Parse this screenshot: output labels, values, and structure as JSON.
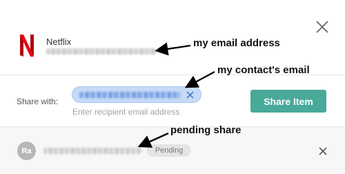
{
  "item": {
    "service_name": "Netflix",
    "owner_email_redacted": "",
    "logo_icon": "netflix-logo",
    "logo_color": "#e50914"
  },
  "share": {
    "label": "Share with:",
    "recipient_chip_redacted": "",
    "hint": "Enter recipient email address",
    "button_label": "Share Item",
    "button_color": "#48a999",
    "chip_color": "#c5daf7"
  },
  "pending": {
    "avatar_initials": "Ra",
    "email_redacted": "",
    "status_badge": "Pending"
  },
  "annotations": {
    "my_email": "my email address",
    "contact_email": "my contact's email",
    "pending_share": "pending share"
  },
  "icons": {
    "close": "close-icon",
    "remove_chip": "close-icon",
    "revoke": "close-icon"
  }
}
